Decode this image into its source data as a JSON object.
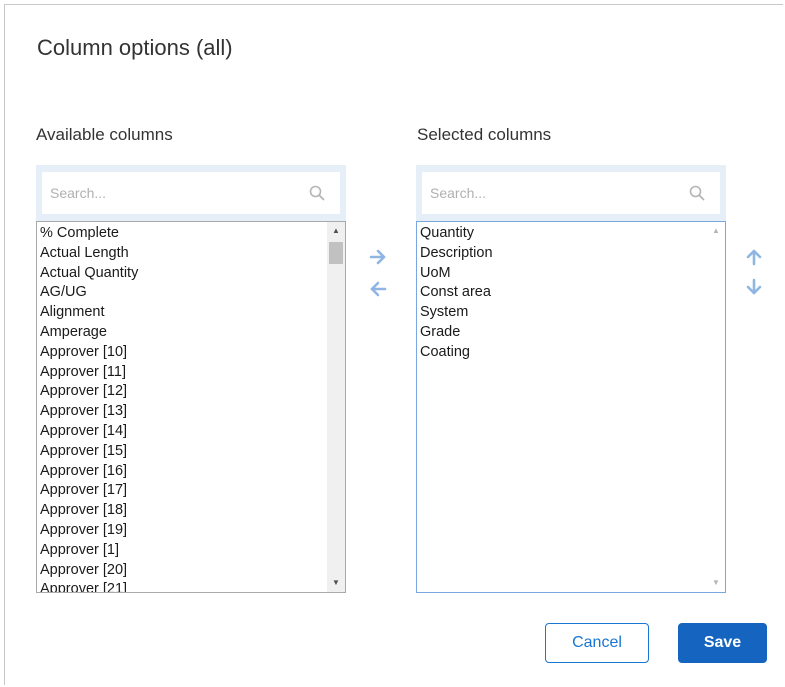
{
  "dialog": {
    "title": "Column options (all)"
  },
  "available": {
    "label": "Available columns",
    "search_placeholder": "Search...",
    "items": [
      "% Complete",
      "Actual Length",
      "Actual Quantity",
      "AG/UG",
      "Alignment",
      "Amperage",
      "Approver [10]",
      "Approver [11]",
      "Approver [12]",
      "Approver [13]",
      "Approver [14]",
      "Approver [15]",
      "Approver [16]",
      "Approver [17]",
      "Approver [18]",
      "Approver [19]",
      "Approver [1]",
      "Approver [20]",
      "Approver [21]"
    ]
  },
  "selected": {
    "label": "Selected columns",
    "search_placeholder": "Search...",
    "items": [
      "Quantity",
      "Description",
      "UoM",
      "Const area",
      "System",
      "Grade",
      "Coating"
    ]
  },
  "transfer": {
    "add_icon": "arrow-right-icon",
    "remove_icon": "arrow-left-icon",
    "move_up_icon": "arrow-up-icon",
    "move_down_icon": "arrow-down-icon"
  },
  "actions": {
    "cancel_label": "Cancel",
    "save_label": "Save"
  },
  "colors": {
    "accent": "#1565c0",
    "search_frame": "#e6eef8",
    "arrow": "#8fb6e3"
  }
}
